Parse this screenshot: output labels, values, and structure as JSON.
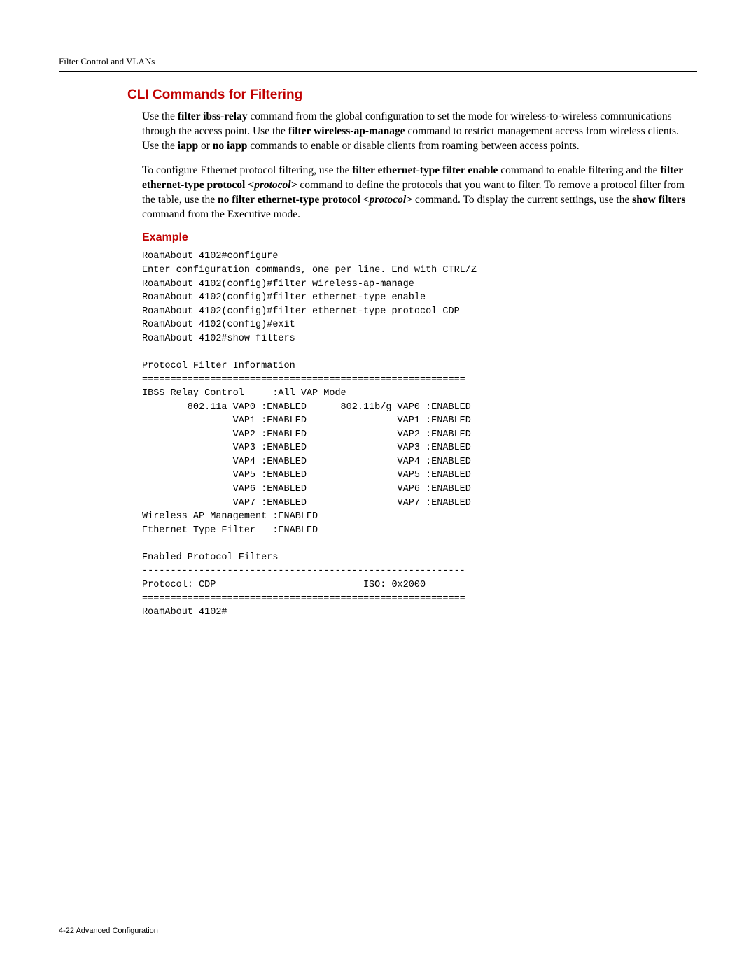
{
  "header": {
    "title": "Filter Control and VLANs"
  },
  "section": {
    "title": "CLI Commands for Filtering"
  },
  "para1": {
    "t1": "Use the ",
    "b1": "filter ibss-relay",
    "t2": " command from the global configuration to set the mode for wireless-to-wireless communications through the access point. Use the ",
    "b2": "filter wireless-ap-manage",
    "t3": " command to restrict management access from wireless clients. Use the ",
    "b3": "iapp",
    "t4": " or ",
    "b4": "no iapp",
    "t5": " commands to enable or disable clients from roaming between access points."
  },
  "para2": {
    "t1": "To configure Ethernet protocol filtering, use the ",
    "b1": "filter ethernet-type filter enable",
    "t2": " command to enable filtering and the ",
    "b2": "filter ethernet-type protocol ",
    "i1": "<protocol>",
    "t3": " command to define the protocols that you want to filter. To remove a protocol filter from the table, use the ",
    "b3": "no filter ethernet-type protocol ",
    "i2": "<protocol>",
    "t4": " command. To display the current settings, use the ",
    "b4": "show filters",
    "t5": " command from the Executive mode."
  },
  "example": {
    "title": "Example",
    "output": "RoamAbout 4102#configure\nEnter configuration commands, one per line. End with CTRL/Z\nRoamAbout 4102(config)#filter wireless-ap-manage\nRoamAbout 4102(config)#filter ethernet-type enable\nRoamAbout 4102(config)#filter ethernet-type protocol CDP\nRoamAbout 4102(config)#exit\nRoamAbout 4102#show filters\n\nProtocol Filter Information\n=========================================================\nIBSS Relay Control     :All VAP Mode\n        802.11a VAP0 :ENABLED      802.11b/g VAP0 :ENABLED\n                VAP1 :ENABLED                VAP1 :ENABLED\n                VAP2 :ENABLED                VAP2 :ENABLED\n                VAP3 :ENABLED                VAP3 :ENABLED\n                VAP4 :ENABLED                VAP4 :ENABLED\n                VAP5 :ENABLED                VAP5 :ENABLED\n                VAP6 :ENABLED                VAP6 :ENABLED\n                VAP7 :ENABLED                VAP7 :ENABLED\nWireless AP Management :ENABLED\nEthernet Type Filter   :ENABLED\n\nEnabled Protocol Filters\n---------------------------------------------------------\nProtocol: CDP                          ISO: 0x2000\n=========================================================\nRoamAbout 4102#"
  },
  "footer": {
    "text": "4-22   Advanced Configuration"
  }
}
